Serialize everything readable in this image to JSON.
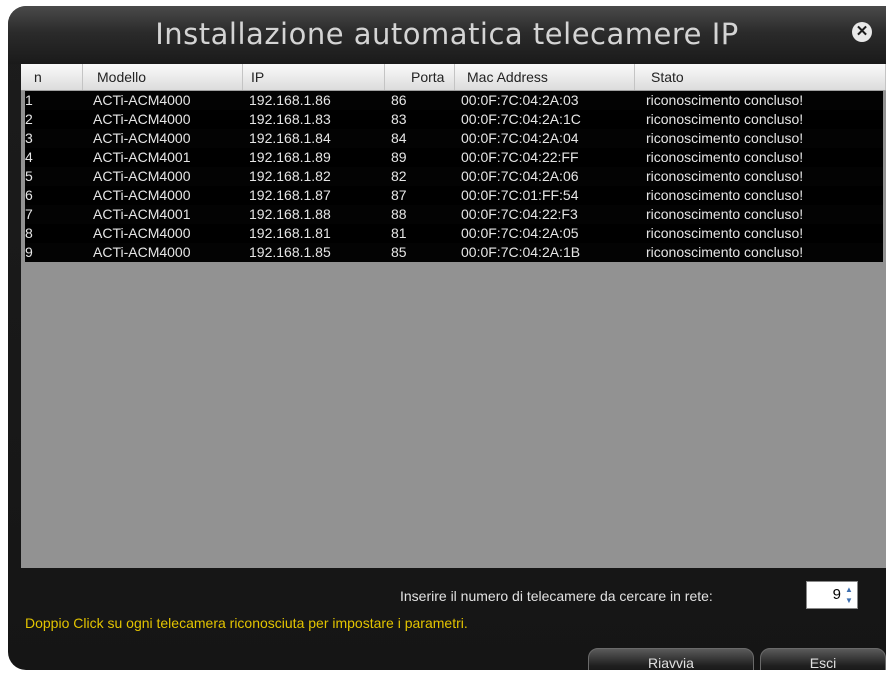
{
  "window": {
    "title": "Installazione automatica telecamere IP"
  },
  "table": {
    "columns": [
      "n",
      "Modello",
      "IP",
      "Porta",
      "Mac Address",
      "Stato"
    ],
    "rows": [
      [
        "1",
        "ACTi-ACM4000",
        "192.168.1.86",
        "86",
        "00:0F:7C:04:2A:03",
        "riconoscimento concluso!"
      ],
      [
        "2",
        "ACTi-ACM4000",
        "192.168.1.83",
        "83",
        "00:0F:7C:04:2A:1C",
        "riconoscimento concluso!"
      ],
      [
        "3",
        "ACTi-ACM4000",
        "192.168.1.84",
        "84",
        "00:0F:7C:04:2A:04",
        "riconoscimento concluso!"
      ],
      [
        "4",
        "ACTi-ACM4001",
        "192.168.1.89",
        "89",
        "00:0F:7C:04:22:FF",
        "riconoscimento concluso!"
      ],
      [
        "5",
        "ACTi-ACM4000",
        "192.168.1.82",
        "82",
        "00:0F:7C:04:2A:06",
        "riconoscimento concluso!"
      ],
      [
        "6",
        "ACTi-ACM4000",
        "192.168.1.87",
        "87",
        "00:0F:7C:01:FF:54",
        "riconoscimento concluso!"
      ],
      [
        "7",
        "ACTi-ACM4001",
        "192.168.1.88",
        "88",
        "00:0F:7C:04:22:F3",
        "riconoscimento concluso!"
      ],
      [
        "8",
        "ACTi-ACM4000",
        "192.168.1.81",
        "81",
        "00:0F:7C:04:2A:05",
        "riconoscimento concluso!"
      ],
      [
        "9",
        "ACTi-ACM4000",
        "192.168.1.85",
        "85",
        "00:0F:7C:04:2A:1B",
        "riconoscimento concluso!"
      ]
    ]
  },
  "footer": {
    "prompt": "Inserire il numero di telecamere da cercare in rete:",
    "count_value": "9",
    "hint": "Doppio Click su ogni telecamera riconosciuta per impostare i parametri.",
    "restart_label": "Riavvia",
    "exit_label": "Esci"
  },
  "icons": {
    "close": "close-icon",
    "spinner": "spinner-arrows-icon"
  },
  "colors": {
    "hint": "#e3c400",
    "background": "#151515",
    "list_area": "#929292"
  }
}
